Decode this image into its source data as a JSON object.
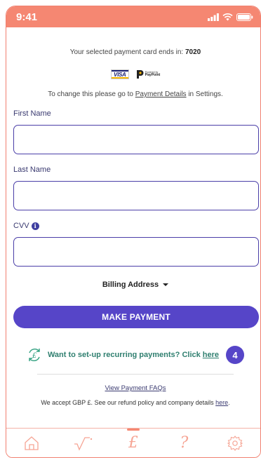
{
  "status_bar": {
    "time": "9:41"
  },
  "payment": {
    "card_text": "Your selected payment card ends in:",
    "card_last4": "7020",
    "logos": {
      "visa": "VISA",
      "paypoint_small": "Powered by",
      "paypoint_name": "PayPoint"
    },
    "change_prefix": "To change this please go to",
    "change_link": "Payment Details",
    "change_suffix": "in Settings."
  },
  "form": {
    "first_name_label": "First Name",
    "first_name_value": "",
    "last_name_label": "Last Name",
    "last_name_value": "",
    "cvv_label": "CVV",
    "cvv_value": "",
    "billing_label": "Billing Address",
    "pay_button": "MAKE PAYMENT"
  },
  "recurring": {
    "text": "Want to set-up recurring payments? Click",
    "link": "here",
    "badge": "4"
  },
  "footer": {
    "faq_link": "View Payment FAQs",
    "accept_text": "We accept GBP £. See our refund policy and company details",
    "accept_link": "here",
    "accept_end": "."
  },
  "tab_bar": {
    "active": "payments",
    "tabs": [
      {
        "name": "home",
        "icon": "home-icon"
      },
      {
        "name": "usage",
        "icon": "graph-icon"
      },
      {
        "name": "payments",
        "icon": "pound-icon",
        "glyph": "£"
      },
      {
        "name": "help",
        "icon": "question-icon",
        "glyph": "?"
      },
      {
        "name": "settings",
        "icon": "gear-icon"
      }
    ]
  },
  "colors": {
    "accent": "#f58772",
    "primary": "#5645c8",
    "link_green": "#2f7f6f"
  }
}
